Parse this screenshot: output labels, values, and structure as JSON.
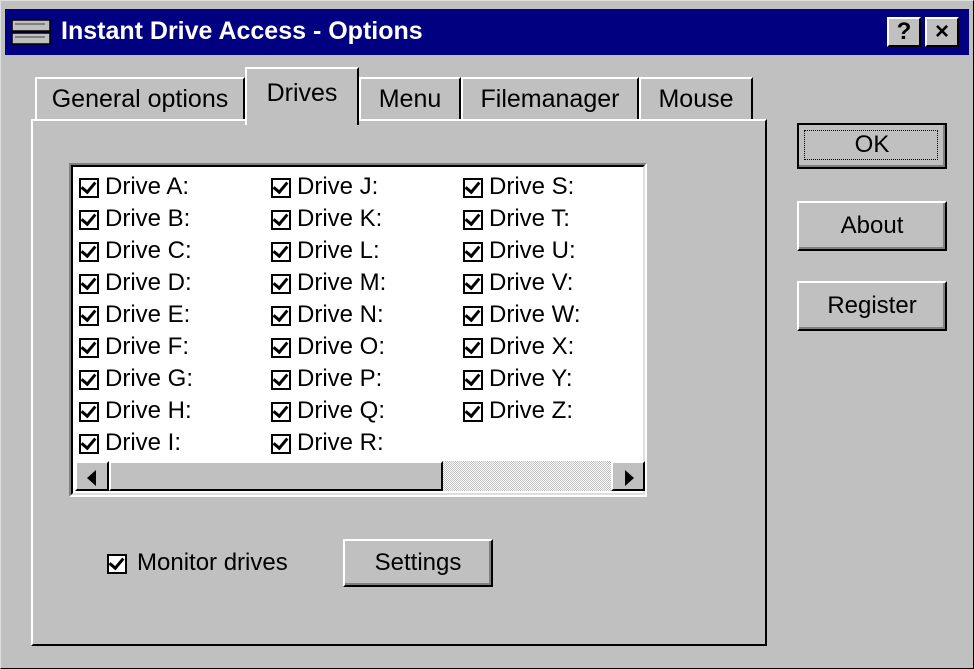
{
  "window": {
    "title": "Instant Drive Access - Options",
    "help_label": "?",
    "close_label": "×"
  },
  "tabs": [
    {
      "label": "General options",
      "active": false
    },
    {
      "label": "Drives",
      "active": true
    },
    {
      "label": "Menu",
      "active": false
    },
    {
      "label": "Filemanager",
      "active": false
    },
    {
      "label": "Mouse",
      "active": false
    }
  ],
  "drives": {
    "columns": [
      [
        "Drive A:",
        "Drive B:",
        "Drive C:",
        "Drive D:",
        "Drive E:",
        "Drive F:",
        "Drive G:",
        "Drive H:",
        "Drive I:"
      ],
      [
        "Drive J:",
        "Drive K:",
        "Drive L:",
        "Drive M:",
        "Drive N:",
        "Drive O:",
        "Drive P:",
        "Drive Q:",
        "Drive R:"
      ],
      [
        "Drive S:",
        "Drive T:",
        "Drive U:",
        "Drive V:",
        "Drive W:",
        "Drive X:",
        "Drive Y:",
        "Drive Z:"
      ]
    ],
    "all_checked": true
  },
  "monitor": {
    "label": "Monitor drives",
    "checked": true,
    "settings_label": "Settings"
  },
  "buttons": {
    "ok": "OK",
    "about": "About",
    "register": "Register"
  },
  "colors": {
    "titlebar": "#000080",
    "face": "#c0c0c0"
  }
}
